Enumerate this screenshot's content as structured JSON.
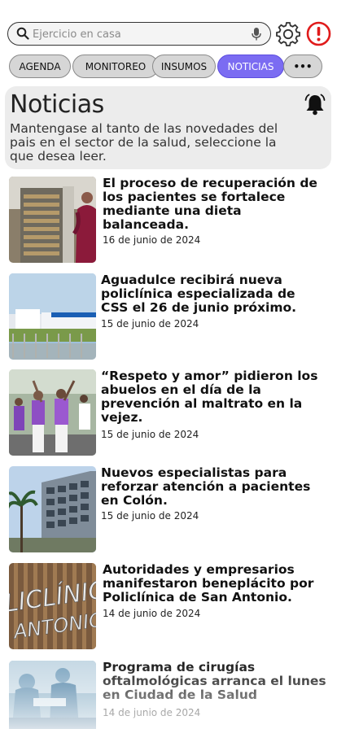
{
  "search": {
    "placeholder": "Ejercicio en casa"
  },
  "icons": {
    "search": "search-icon",
    "mic": "mic-icon",
    "settings": "gear-icon",
    "alert": "alert-icon",
    "notifications": "bell-icon"
  },
  "colors": {
    "accent": "#7b6cf2",
    "alert": "#e01b1b",
    "chip_bg": "#d6d6d6",
    "header_bg": "#ececec"
  },
  "tabs": [
    {
      "label": "AGENDA"
    },
    {
      "label": "MONITOREO"
    },
    {
      "label": "INSUMOS"
    },
    {
      "label": "NOTICIAS",
      "active": true
    },
    {
      "label": "•••"
    }
  ],
  "header": {
    "title": "Noticias",
    "subtitle": "Mantengase al tanto de las novedades del pais en el sector de la salud, seleccione la que desea leer."
  },
  "news": [
    {
      "title": "El proceso de recuperación de los pacientes se fortalece mediante una dieta balanceada.",
      "date": "16 de junio de 2024"
    },
    {
      "title": "Aguadulce recibirá nueva policlínica especializada de CSS el 26 de junio próximo.",
      "date": "15 de junio de 2024"
    },
    {
      "title": "“Respeto y amor” pidieron los abuelos en el día de la prevención al maltrato en la vejez.",
      "date": "15 de junio de 2024"
    },
    {
      "title": "Nuevos especialistas para reforzar atención a pacientes en Colón.",
      "date": "15 de junio de 2024"
    },
    {
      "title": "Autoridades y empresarios manifestaron beneplácito por Policlínica de San Antonio.",
      "date": "14 de junio de 2024"
    },
    {
      "title": "Programa de cirugías oftalmológicas arranca el lunes en Ciudad de la Salud",
      "date": "14 de junio de 2024"
    }
  ],
  "thumb_texts": {
    "policlinica_sign": "LICLÍNICA",
    "policlinica_sign2": "ANTONIO"
  }
}
